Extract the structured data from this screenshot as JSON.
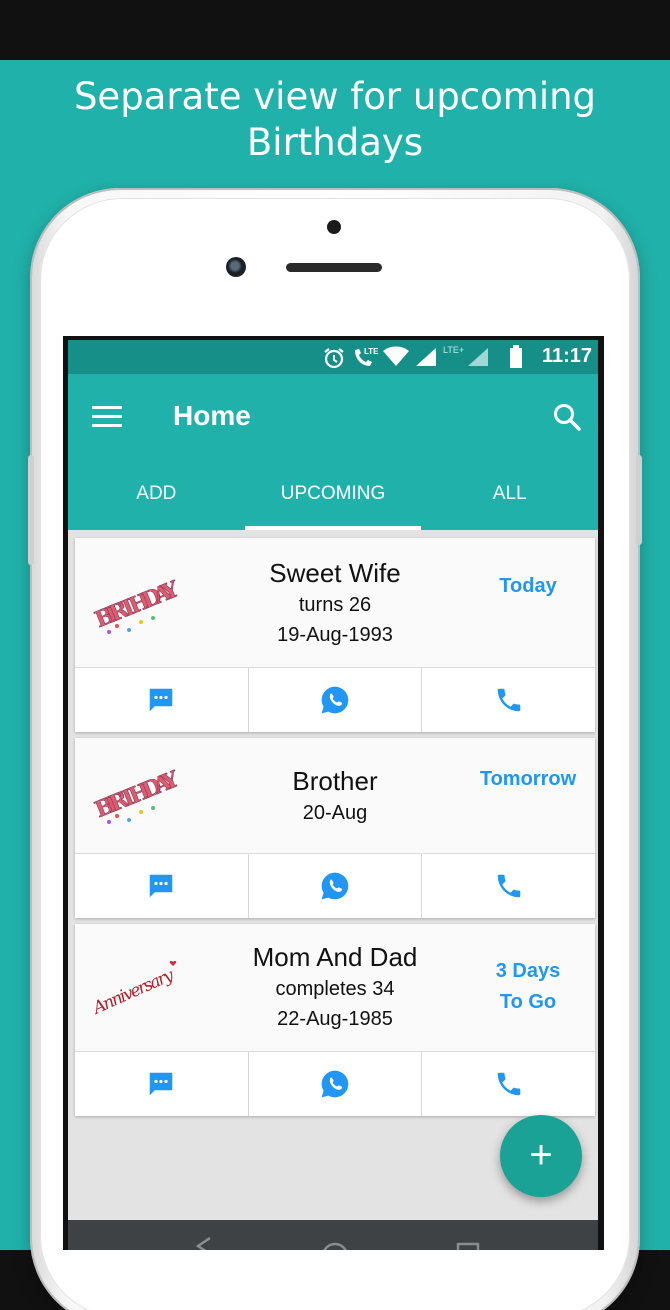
{
  "headline": {
    "line1": "Separate view for upcoming",
    "line2": "Birthdays"
  },
  "status_bar": {
    "time": "11:17",
    "icons": [
      "alarm-icon",
      "lte-call-icon",
      "wifi-icon",
      "signal-icon",
      "lte-plus-signal-icon",
      "battery-icon"
    ],
    "lte_label": "LTE",
    "lte_plus_label": "LTE+"
  },
  "app_bar": {
    "title": "Home",
    "menu_icon": "menu-icon",
    "search_icon": "search-icon"
  },
  "tabs": [
    {
      "label": "ADD",
      "active": false
    },
    {
      "label": "UPCOMING",
      "active": true
    },
    {
      "label": "ALL",
      "active": false
    }
  ],
  "cards": [
    {
      "image": "birthday-image",
      "image_text": "BIRTHDAY",
      "name": "Sweet Wife",
      "line1": "turns 26",
      "line2": "19-Aug-1993",
      "when1": "Today",
      "when2": ""
    },
    {
      "image": "birthday-image",
      "image_text": "BIRTHDAY",
      "name": "Brother",
      "line1": "20-Aug",
      "line2": "",
      "when1": "Tomorrow",
      "when2": ""
    },
    {
      "image": "anniversary-image",
      "image_text": "Anniversary",
      "name": "Mom And Dad",
      "line1": "completes 34",
      "line2": "22-Aug-1985",
      "when1": "3 Days",
      "when2": "To Go"
    }
  ],
  "card_actions": [
    "message-icon",
    "whatsapp-icon",
    "phone-icon"
  ],
  "fab": {
    "label": "+"
  },
  "colors": {
    "teal": "#20b2aa",
    "status_teal": "#168f89",
    "accent_blue": "#2196f3",
    "fab": "#19a295"
  }
}
